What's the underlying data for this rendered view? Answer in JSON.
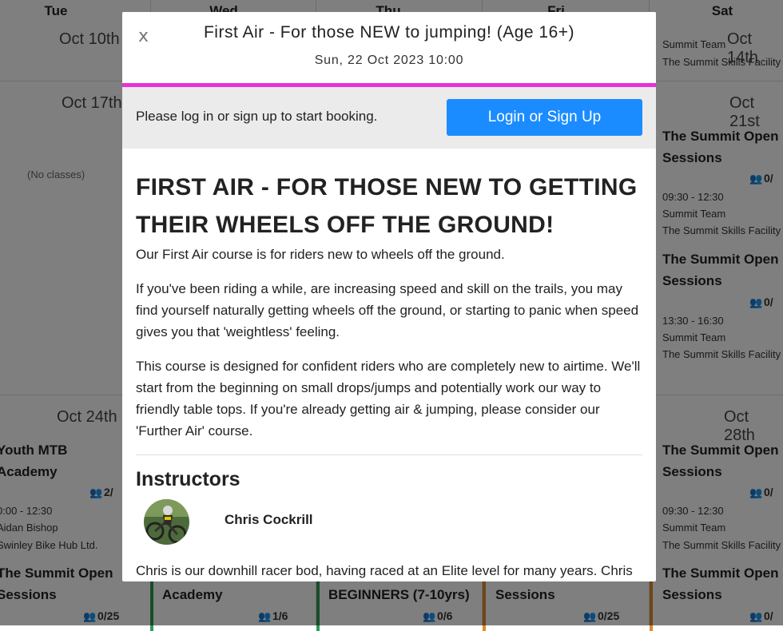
{
  "calendar": {
    "days": [
      "Tue",
      "Wed",
      "Thu",
      "Fri",
      "Sat"
    ],
    "week1": {
      "tue_date": "Oct 10th",
      "sat_date": "Oct 14th",
      "sat_team": "Summit Team",
      "sat_location": "The Summit Skills Facility"
    },
    "week2": {
      "tue_date": "Oct 17th",
      "sat_date": "Oct 21st",
      "no_classes": "(No classes)",
      "sat_events": [
        {
          "title": "The Summit Open Sessions",
          "count": "0/",
          "time": "09:30 - 12:30",
          "team": "Summit Team",
          "location": "The Summit Skills Facility"
        },
        {
          "title": "The Summit Open Sessions",
          "count": "0/",
          "time": "13:30 - 16:30",
          "team": "Summit Team",
          "location": "The Summit Skills Facility"
        }
      ]
    },
    "week3": {
      "tue_date": "Oct 24th",
      "sat_date": "Oct 28th",
      "tue_events": [
        {
          "title": "Youth MTB Academy",
          "count": "2/",
          "time": "0:00 - 12:30",
          "team": "Aidan Bishop",
          "location": "Swinley Bike Hub Ltd."
        },
        {
          "title": "The Summit Open Sessions",
          "count": "0/25"
        }
      ],
      "wed_event": {
        "title": "Academy",
        "count": "1/6"
      },
      "thu_event": {
        "title": "BEGINNERS (7-10yrs)",
        "count": "0/6"
      },
      "fri_event": {
        "title": "Sessions",
        "count": "0/25"
      },
      "sat_events": [
        {
          "title": "The Summit Open Sessions",
          "count": "0/",
          "time": "09:30 - 12:30",
          "team": "Summit Team",
          "location": "The Summit Skills Facility"
        },
        {
          "title": "The Summit Open Sessions",
          "count": "0/"
        }
      ]
    }
  },
  "modal": {
    "close_label": "x",
    "title": "First Air - For those NEW to jumping! (Age 16+)",
    "datetime": "Sun, 22 Oct 2023 10:00",
    "accent_color": "#e632d6",
    "login_message": "Please log in or sign up to start booking.",
    "login_button": "Login or Sign Up",
    "login_button_color": "#1b8cff",
    "course_heading": "FIRST AIR - FOR THOSE NEW TO GETTING THEIR WHEELS OFF THE GROUND!",
    "paragraphs": [
      "Our First Air course is for riders new to wheels off the ground.",
      "If you've been riding a while, are increasing speed and skill on the trails, you may find yourself naturally getting wheels off the ground, or starting to panic when speed gives you that 'weightless' feeling.",
      "This course is designed for confident riders who are completely new to airtime. We'll start from the beginning on small drops/jumps and potentially work our way to friendly table tops.  If you're already getting air & jumping, please consider our 'Further Air' course."
    ],
    "instructors_heading": "Instructors",
    "instructor_name": "Chris Cockrill",
    "instructor_bio": "Chris is our downhill racer bod, having raced at an Elite level for many years. Chris"
  }
}
